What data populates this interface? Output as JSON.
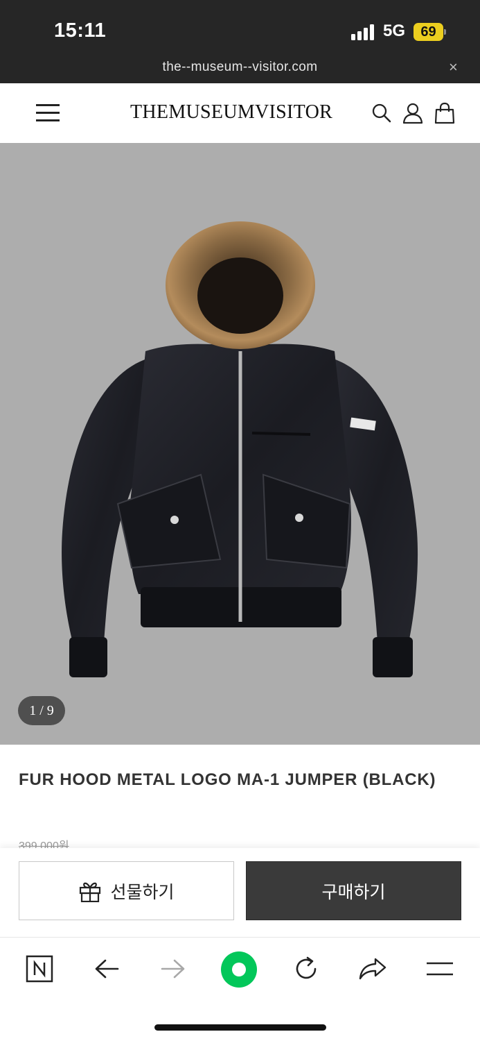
{
  "status_bar": {
    "time": "15:11",
    "network": "5G",
    "battery": "69",
    "url": "the--museum--visitor.com",
    "close_glyph": "×"
  },
  "header": {
    "brand": "THEMUSEUMVISITOR",
    "icons": [
      "menu-icon",
      "search-icon",
      "account-icon",
      "shopping-bag-icon"
    ]
  },
  "gallery": {
    "image": "black fur-hood MA-1 bomber jacket on grey background",
    "counter": "1 / 9",
    "current": 1,
    "total": 9
  },
  "product": {
    "title": "FUR HOOD METAL LOGO MA-1 JUMPER (BLACK)",
    "original_price": "399,000원"
  },
  "actions": {
    "gift_label": "선물하기",
    "buy_label": "구매하기"
  },
  "browser_toolbar": {
    "icons": [
      "naver-n-icon",
      "back-arrow-icon",
      "forward-arrow-icon",
      "green-circle-icon",
      "reload-icon",
      "share-icon",
      "menu-lines-icon"
    ]
  },
  "colors": {
    "status_bar_bg": "#262626",
    "gallery_bg": "#adadad",
    "buy_button_bg": "#3a3a3a",
    "battery_yellow": "#ecce1f",
    "naver_green": "#03c75a"
  }
}
